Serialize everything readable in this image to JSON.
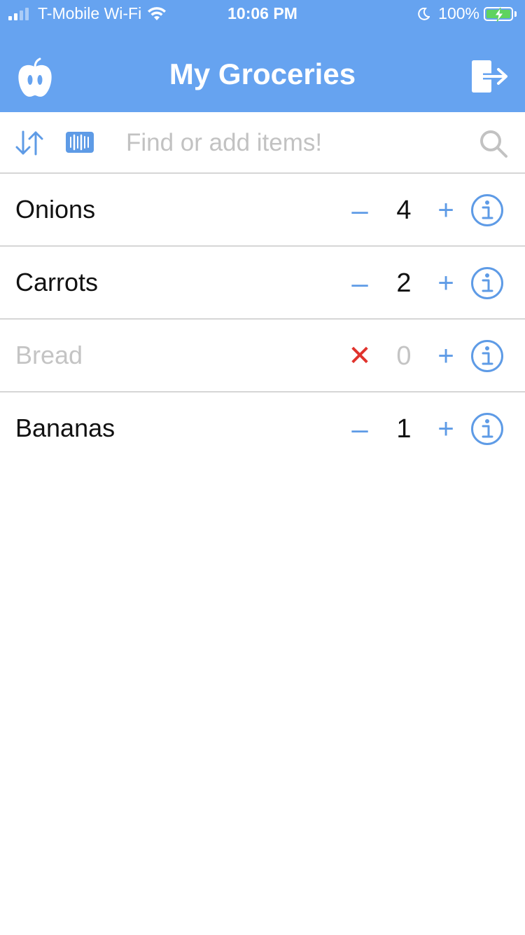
{
  "status_bar": {
    "carrier": "T-Mobile Wi-Fi",
    "time": "10:06 PM",
    "battery": "100%"
  },
  "header": {
    "title": "My Groceries",
    "left_icon": "apple-icon",
    "right_icon": "logout-icon"
  },
  "toolbar": {
    "sort_icon": "sort-arrows-icon",
    "barcode_icon": "barcode-icon",
    "search_placeholder": "Find or add items!",
    "search_value": "",
    "search_icon": "search-icon"
  },
  "items": [
    {
      "name": "Onions",
      "quantity": "4",
      "minus": "–",
      "plus": "+"
    },
    {
      "name": "Carrots",
      "quantity": "2",
      "minus": "–",
      "plus": "+"
    },
    {
      "name": "Bread",
      "quantity": "0",
      "remove": "✕",
      "plus": "+"
    },
    {
      "name": "Bananas",
      "quantity": "1",
      "minus": "–",
      "plus": "+"
    }
  ],
  "colors": {
    "accent": "#66A3F0",
    "icon_blue": "#5E9BE6",
    "remove_red": "#E0322C",
    "placeholder_gray": "#C2C2C2",
    "divider": "#D6D6D6"
  }
}
